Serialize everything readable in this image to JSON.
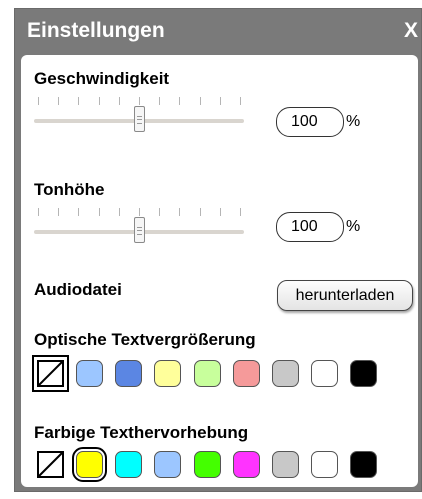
{
  "dialog": {
    "title": "Einstellungen",
    "close_label": "X"
  },
  "speed": {
    "label": "Geschwindigkeit",
    "value": "100",
    "unit": "%",
    "slider_fraction": 0.5
  },
  "pitch": {
    "label": "Tonhöhe",
    "value": "100",
    "unit": "%",
    "slider_fraction": 0.5
  },
  "audio": {
    "label": "Audiodatei",
    "button_label": "herunterladen"
  },
  "magnification": {
    "label": "Optische Textvergrößerung",
    "selected": "none",
    "colors": [
      "#9cc6ff",
      "#5b86e3",
      "#ffff9b",
      "#c8ff9c",
      "#f59a9a",
      "#c8c8c8",
      "#ffffff",
      "#000000"
    ]
  },
  "highlight": {
    "label": "Farbige Texthervorhebung",
    "selected": "#ffff00",
    "colors": [
      "#ffff00",
      "#00ffff",
      "#9cc6ff",
      "#44ff00",
      "#ff33ff",
      "#c8c8c8",
      "#ffffff",
      "#000000"
    ]
  }
}
